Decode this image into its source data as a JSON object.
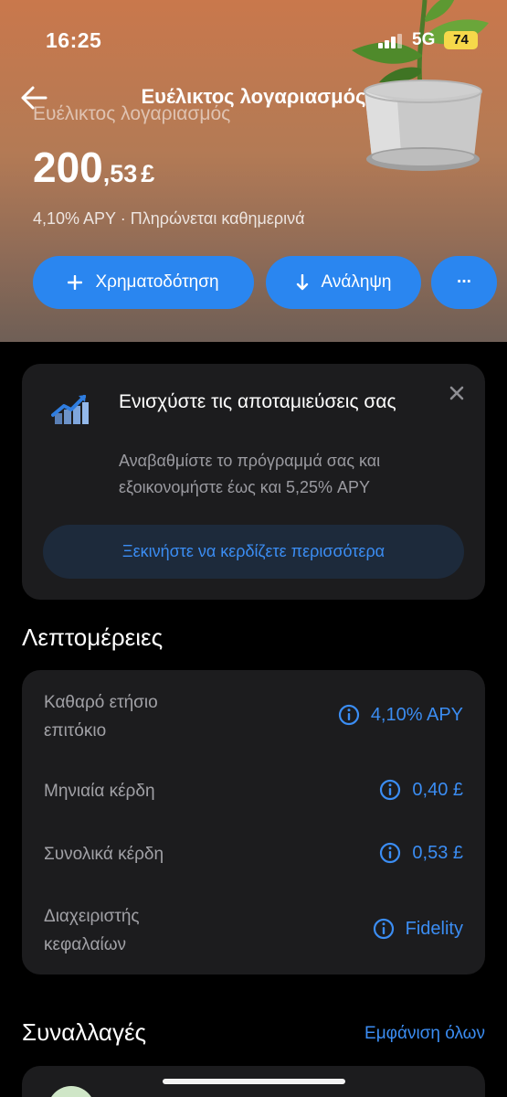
{
  "status_bar": {
    "time": "16:25",
    "network": "5G",
    "battery": "74"
  },
  "header": {
    "nav_title": "Ευέλικτος λογαριασμός",
    "account_label": "Ευέλικτος λογαριασμός",
    "balance_int": "200",
    "balance_dec": ",53",
    "balance_currency": "£",
    "rate_line": "4,10% APY · Πληρώνεται καθημερινά",
    "buttons": {
      "fund": "Χρηματοδότηση",
      "withdraw": "Ανάληψη",
      "more": "···"
    }
  },
  "promo": {
    "title": "Ενισχύστε τις αποταμιεύσεις σας",
    "body": "Αναβαθμίστε το πρόγραμμά σας και εξοικονομήστε έως και 5,25% APY",
    "cta": "Ξεκινήστε να κερδίζετε περισσότερα"
  },
  "details": {
    "title": "Λεπτομέρειες",
    "rows": [
      {
        "label": "Καθαρό ετήσιο επιτόκιο",
        "value": "4,10% APY"
      },
      {
        "label": "Μηνιαία κέρδη",
        "value": "0,40 £"
      },
      {
        "label": "Συνολικά κέρδη",
        "value": "0,53 £"
      },
      {
        "label": "Διαχειριστής κεφαλαίων",
        "value": "Fidelity"
      }
    ]
  },
  "transactions": {
    "title": "Συναλλαγές",
    "see_all": "Εμφάνιση όλων"
  },
  "colors": {
    "accent": "#2a86f0",
    "link": "#3b8df3",
    "card": "#1c1c1e",
    "battery": "#f6d84a"
  }
}
